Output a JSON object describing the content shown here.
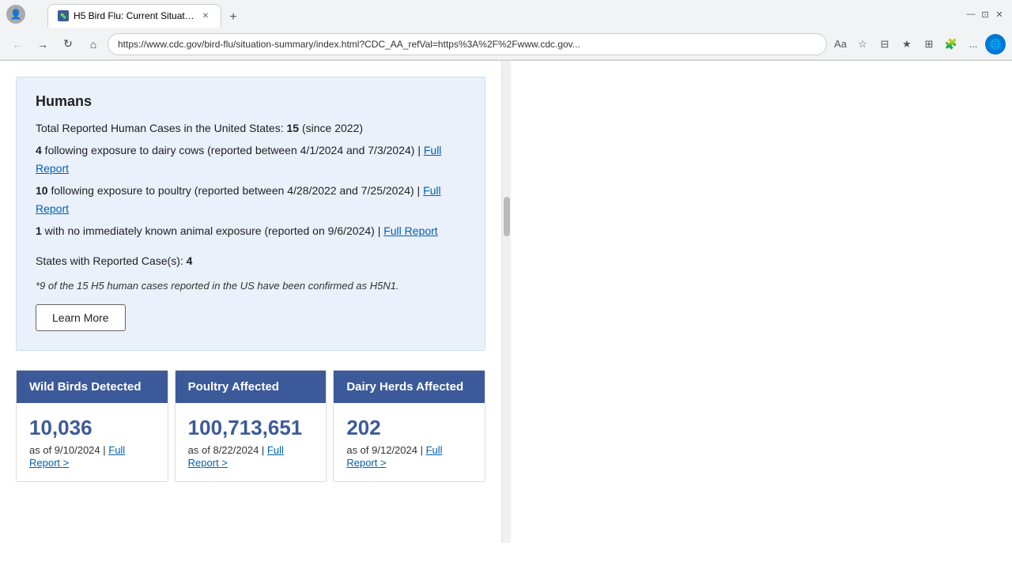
{
  "browser": {
    "title_bar": {
      "profile_icon": "👤"
    },
    "tabs": [
      {
        "id": "tab-1",
        "label": "H5 Bird Flu: Current Situation | B...",
        "active": true,
        "favicon": "🦠"
      }
    ],
    "new_tab_label": "+",
    "nav": {
      "back_label": "←",
      "forward_label": "→",
      "reload_label": "↻",
      "home_label": "⌂"
    },
    "address": "https://www.cdc.gov/bird-flu/situation-summary/index.html?CDC_AA_refVal=https%3A%2F%2Fwww.cdc.gov...",
    "toolbar_icons": {
      "reader": "Aa",
      "bookmark": "☆",
      "split": "⊟",
      "favorites": "★",
      "collections": "⊞",
      "extensions": "🧩",
      "more": "...",
      "profile": "🌐"
    },
    "window_controls": {
      "minimize": "—",
      "maximize": "⊡",
      "close": "✕"
    }
  },
  "page": {
    "humans_section": {
      "title": "Humans",
      "total_cases_text": "Total Reported Human Cases in the United States:",
      "total_cases_number": "15",
      "total_cases_suffix": "(since 2022)",
      "dairy_cases_prefix": "4",
      "dairy_cases_text": " following exposure to dairy cows (reported between 4/1/2024 and 7/3/2024) |",
      "dairy_link": "Full Report",
      "poultry_cases_prefix": "10",
      "poultry_cases_text": " following exposure to poultry (reported between 4/28/2022 and 7/25/2024) |",
      "poultry_link": "Full Report",
      "unknown_cases_prefix": "1",
      "unknown_cases_text": " with no immediately known animal exposure (reported on 9/6/2024) |",
      "unknown_link": "Full Report",
      "states_text": "States with Reported Case(s):",
      "states_number": "4",
      "italic_note": "*9 of the 15 H5 human cases reported in the US have been confirmed as H5N1.",
      "learn_more_label": "Learn More"
    },
    "stats": [
      {
        "id": "wild-birds",
        "header": "Wild Birds Detected",
        "number": "10,036",
        "date": "as of 9/10/2024 |",
        "link": "Full Report >"
      },
      {
        "id": "poultry",
        "header": "Poultry Affected",
        "number": "100,713,651",
        "date": "as of 8/22/2024 |",
        "link": "Full Report >"
      },
      {
        "id": "dairy-herds",
        "header": "Dairy Herds Affected",
        "number": "202",
        "date": "as of 9/12/2024 |",
        "link": "Full Report >"
      }
    ]
  }
}
